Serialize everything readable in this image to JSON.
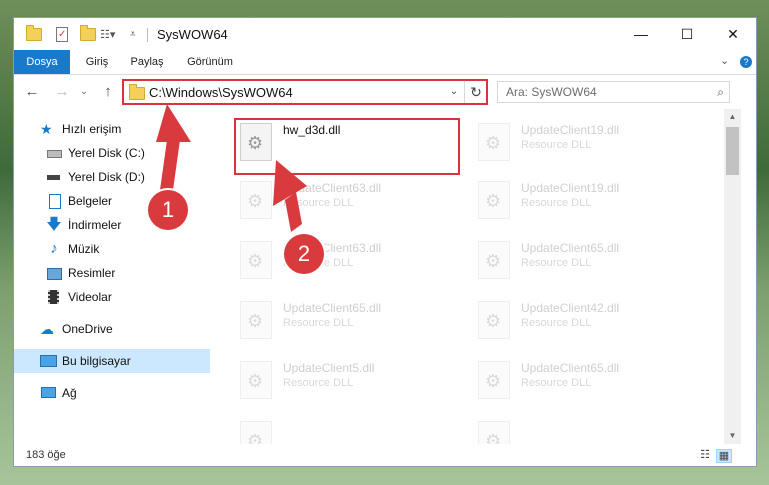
{
  "window": {
    "title": "SysWOW64",
    "controls": {
      "minimize": "—",
      "maximize": "☐",
      "close": "✕"
    }
  },
  "ribbon": {
    "tabs": [
      "Dosya",
      "Giriş",
      "Paylaş",
      "Görünüm"
    ],
    "active_tab": "Dosya",
    "collapse_icon": "⌄",
    "help_icon": "?"
  },
  "address": {
    "path": "C:\\Windows\\SysWOW64",
    "dropdown_icon": "⌄",
    "refresh_icon": "↻"
  },
  "search": {
    "placeholder": "Ara: SysWOW64",
    "icon": "⌕"
  },
  "nav": {
    "back": "←",
    "forward": "→",
    "recent": "⌄",
    "up": "↑"
  },
  "sidebar": {
    "items": [
      {
        "label": "Hızlı erişim",
        "icon": "star-icon"
      },
      {
        "label": "Yerel Disk (C:)",
        "icon": "drive-icon",
        "pinned": true
      },
      {
        "label": "Yerel Disk (D:)",
        "icon": "drive-icon",
        "pinned": true
      },
      {
        "label": "Belgeler",
        "icon": "documents-icon",
        "pinned": true
      },
      {
        "label": "İndirmeler",
        "icon": "download-icon",
        "pinned": true
      },
      {
        "label": "Müzik",
        "icon": "music-icon",
        "pinned": true
      },
      {
        "label": "Resimler",
        "icon": "pictures-icon",
        "pinned": true
      },
      {
        "label": "Videolar",
        "icon": "videos-icon",
        "pinned": true
      },
      {
        "label": "OneDrive",
        "icon": "cloud-icon"
      },
      {
        "label": "Bu bilgisayar",
        "icon": "computer-icon",
        "selected": true
      },
      {
        "label": "Ağ",
        "icon": "network-icon"
      }
    ],
    "pin_glyph": "📌"
  },
  "files": {
    "left": [
      {
        "name": "hw_d3d.dll",
        "desc": ""
      },
      {
        "name": "UpdateClient63.dll",
        "desc": "Resource DLL"
      },
      {
        "name": "UpdateClient63.dll",
        "desc": "Resource DLL"
      },
      {
        "name": "UpdateClient65.dll",
        "desc": "Resource DLL"
      },
      {
        "name": "UpdateClient5.dll",
        "desc": "Resource DLL"
      },
      {
        "name": "",
        "desc": ""
      }
    ],
    "right": [
      {
        "name": "UpdateClient19.dll",
        "desc": "Resource DLL"
      },
      {
        "name": "UpdateClient19.dll",
        "desc": "Resource DLL"
      },
      {
        "name": "UpdateClient65.dll",
        "desc": "Resource DLL"
      },
      {
        "name": "UpdateClient42.dll",
        "desc": "Resource DLL"
      },
      {
        "name": "UpdateClient65.dll",
        "desc": "Resource DLL"
      },
      {
        "name": "",
        "desc": ""
      }
    ]
  },
  "status": {
    "item_count": "183 öğe"
  },
  "annotations": {
    "step1": "1",
    "step2": "2",
    "color": "#d83a3e"
  }
}
